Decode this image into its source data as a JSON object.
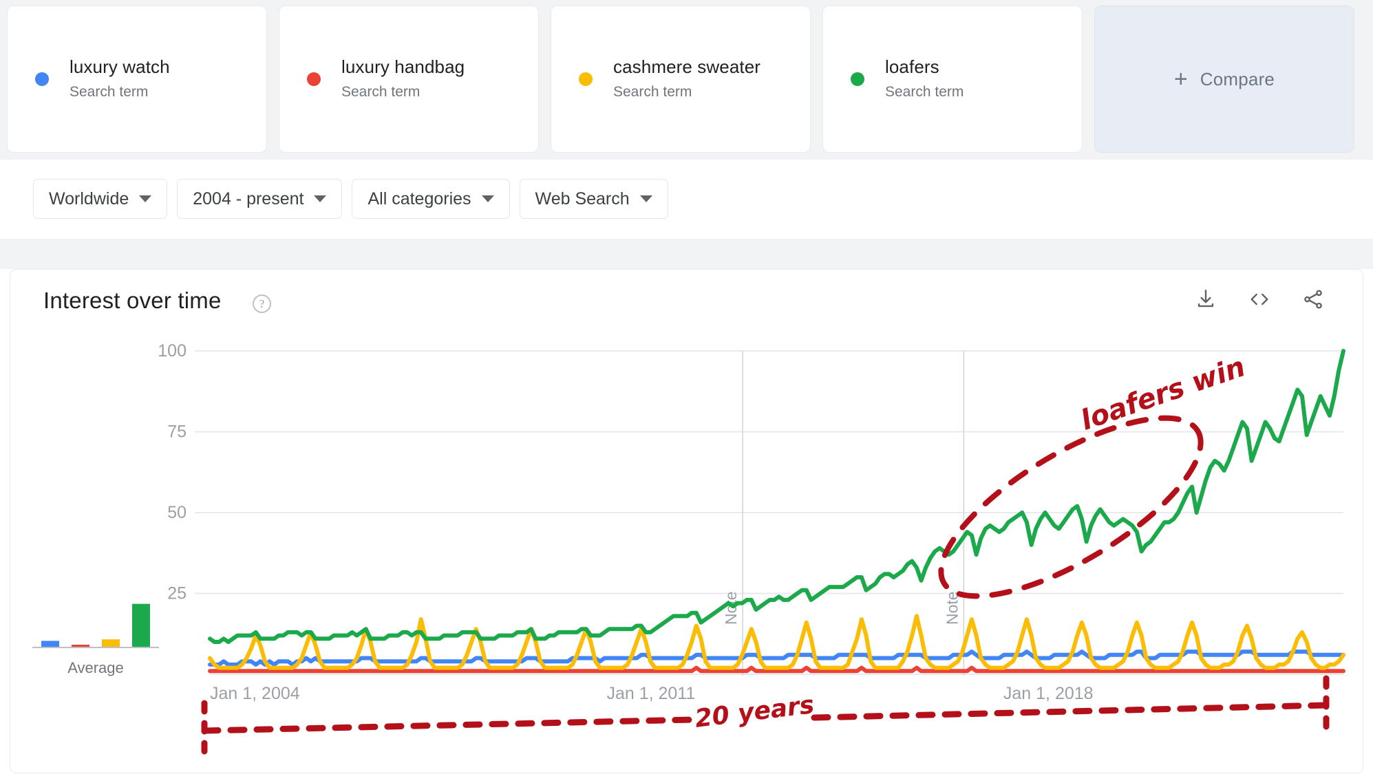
{
  "terms": [
    {
      "name": "luxury watch",
      "type_label": "Search term",
      "color": "#4285F4",
      "dot_icon": "series-dot-icon"
    },
    {
      "name": "luxury handbag",
      "type_label": "Search term",
      "color": "#EA4335",
      "dot_icon": "series-dot-icon"
    },
    {
      "name": "cashmere sweater",
      "type_label": "Search term",
      "color": "#FBBC05",
      "dot_icon": "series-dot-icon"
    },
    {
      "name": "loafers",
      "type_label": "Search term",
      "color": "#1BA94C",
      "dot_icon": "series-dot-icon"
    }
  ],
  "compare": {
    "label": "Compare",
    "plus_icon": "plus-icon"
  },
  "filters": [
    {
      "name": "region",
      "value": "Worldwide",
      "caret_icon": "chevron-down-icon"
    },
    {
      "name": "time",
      "value": "2004 - present",
      "caret_icon": "chevron-down-icon"
    },
    {
      "name": "category",
      "value": "All categories",
      "caret_icon": "chevron-down-icon"
    },
    {
      "name": "search_type",
      "value": "Web Search",
      "caret_icon": "chevron-down-icon"
    }
  ],
  "panel": {
    "title": "Interest over time",
    "help_icon": "help-circle-icon",
    "actions": [
      {
        "name": "download",
        "icon": "download-icon"
      },
      {
        "name": "embed",
        "icon": "code-embed-icon"
      },
      {
        "name": "share",
        "icon": "share-icon"
      }
    ]
  },
  "mini_chart": {
    "label": "Average",
    "values": [
      4,
      1,
      5,
      29
    ]
  },
  "annotations": {
    "loafers_win": "loafers win",
    "twenty_years": "20 years",
    "note_marker_label": "Note"
  },
  "chart_data": {
    "type": "line",
    "title": "Interest over time",
    "xlabel": "",
    "ylabel": "",
    "ylim": [
      0,
      100
    ],
    "yticks": [
      25,
      50,
      75,
      100
    ],
    "grid": true,
    "legend_position": "top-cards",
    "xtick_labels": [
      "Jan 1, 2004",
      "Jan 1, 2011",
      "Jan 1, 2018"
    ],
    "xtick_positions": [
      0,
      0.35,
      0.7
    ],
    "note_markers": [
      0.47,
      0.665
    ],
    "series": [
      {
        "name": "luxury watch",
        "color": "#4285F4",
        "values": [
          3,
          3,
          3,
          4,
          3,
          3,
          3,
          4,
          4,
          4,
          3,
          4,
          3,
          4,
          3,
          4,
          4,
          4,
          3,
          4,
          4,
          5,
          4,
          5,
          4,
          4,
          4,
          4,
          4,
          4,
          4,
          4,
          4,
          5,
          5,
          5,
          4,
          4,
          4,
          4,
          4,
          4,
          4,
          4,
          4,
          4,
          5,
          5,
          4,
          4,
          4,
          4,
          4,
          4,
          4,
          4,
          4,
          4,
          5,
          5,
          4,
          4,
          4,
          4,
          4,
          4,
          4,
          4,
          4,
          5,
          5,
          5,
          4,
          4,
          4,
          4,
          4,
          4,
          4,
          5,
          5,
          5,
          5,
          5,
          5,
          4,
          5,
          5,
          5,
          5,
          5,
          5,
          5,
          5,
          6,
          6,
          5,
          5,
          5,
          5,
          5,
          5,
          5,
          5,
          5,
          5,
          6,
          6,
          5,
          5,
          5,
          5,
          5,
          5,
          5,
          5,
          5,
          6,
          6,
          6,
          5,
          5,
          5,
          5,
          5,
          5,
          6,
          6,
          6,
          6,
          6,
          6,
          5,
          5,
          5,
          5,
          5,
          6,
          6,
          6,
          6,
          6,
          6,
          6,
          5,
          5,
          5,
          5,
          5,
          5,
          6,
          6,
          6,
          6,
          6,
          6,
          5,
          5,
          5,
          5,
          5,
          5,
          6,
          6,
          6,
          6,
          7,
          6,
          5,
          5,
          5,
          5,
          5,
          6,
          6,
          6,
          6,
          6,
          7,
          6,
          5,
          5,
          5,
          5,
          6,
          6,
          6,
          6,
          6,
          6,
          7,
          6,
          5,
          5,
          5,
          5,
          6,
          6,
          6,
          6,
          6,
          6,
          7,
          7,
          5,
          5,
          5,
          6,
          6,
          6,
          6,
          6,
          6,
          7,
          7,
          7,
          6,
          6,
          6,
          6,
          6,
          6,
          6,
          6,
          6,
          7,
          7,
          7,
          6,
          6,
          6,
          6,
          6,
          6,
          6,
          6,
          7,
          7,
          7,
          7,
          6,
          6,
          6,
          6,
          6,
          6,
          6,
          6
        ]
      },
      {
        "name": "luxury handbag",
        "color": "#EA4335",
        "values": [
          1,
          1,
          1,
          1,
          1,
          1,
          1,
          1,
          1,
          1,
          1,
          1,
          1,
          1,
          1,
          1,
          1,
          1,
          1,
          1,
          1,
          1,
          1,
          1,
          1,
          1,
          1,
          1,
          1,
          1,
          1,
          1,
          1,
          1,
          1,
          1,
          1,
          1,
          1,
          1,
          1,
          1,
          1,
          1,
          1,
          1,
          1,
          1,
          1,
          1,
          1,
          1,
          1,
          1,
          1,
          1,
          1,
          1,
          1,
          1,
          1,
          1,
          1,
          1,
          1,
          1,
          1,
          1,
          1,
          1,
          1,
          1,
          1,
          1,
          1,
          1,
          1,
          1,
          1,
          1,
          1,
          1,
          1,
          1,
          1,
          1,
          1,
          1,
          1,
          1,
          1,
          1,
          1,
          1,
          1,
          1,
          1,
          1,
          1,
          1,
          1,
          1,
          1,
          1,
          1,
          1,
          2,
          1,
          1,
          1,
          1,
          1,
          1,
          1,
          1,
          1,
          1,
          1,
          2,
          1,
          1,
          1,
          1,
          1,
          1,
          1,
          1,
          1,
          1,
          1,
          2,
          1,
          1,
          1,
          1,
          1,
          1,
          1,
          1,
          1,
          1,
          1,
          2,
          1,
          1,
          1,
          1,
          1,
          1,
          1,
          1,
          1,
          1,
          1,
          2,
          1,
          1,
          1,
          1,
          1,
          1,
          1,
          1,
          1,
          1,
          1,
          2,
          1,
          1,
          1,
          1,
          1,
          1,
          1,
          1,
          1,
          1,
          1,
          1,
          1,
          1,
          1,
          1,
          1,
          1,
          1,
          1,
          1,
          1,
          1,
          1,
          1,
          1,
          1,
          1,
          1,
          1,
          1,
          1,
          1,
          1,
          1,
          1,
          1,
          1,
          1,
          1,
          1,
          1,
          1,
          1,
          1,
          1,
          1,
          1,
          1,
          1,
          1,
          1,
          1,
          1,
          1,
          1,
          1,
          1,
          1,
          1,
          1,
          1,
          1,
          1,
          1,
          1,
          1,
          1,
          1,
          1,
          1,
          1,
          1,
          1,
          1,
          1,
          1,
          1,
          1,
          1,
          1
        ]
      },
      {
        "name": "cashmere sweater",
        "color": "#FBBC05",
        "values": [
          5,
          3,
          2,
          2,
          2,
          2,
          2,
          3,
          5,
          8,
          12,
          9,
          4,
          2,
          2,
          2,
          2,
          2,
          2,
          3,
          5,
          9,
          13,
          9,
          4,
          2,
          2,
          2,
          2,
          2,
          2,
          3,
          5,
          9,
          14,
          10,
          4,
          2,
          2,
          2,
          2,
          2,
          2,
          3,
          6,
          10,
          17,
          11,
          4,
          2,
          2,
          2,
          2,
          2,
          2,
          3,
          6,
          10,
          14,
          10,
          4,
          2,
          2,
          2,
          2,
          2,
          2,
          3,
          6,
          10,
          14,
          10,
          4,
          2,
          2,
          2,
          2,
          2,
          2,
          3,
          6,
          10,
          14,
          10,
          4,
          2,
          2,
          2,
          2,
          2,
          2,
          3,
          6,
          10,
          14,
          10,
          4,
          2,
          2,
          2,
          2,
          2,
          2,
          3,
          6,
          10,
          15,
          11,
          4,
          2,
          2,
          2,
          2,
          2,
          2,
          3,
          6,
          10,
          14,
          10,
          4,
          2,
          2,
          2,
          2,
          2,
          2,
          3,
          6,
          11,
          16,
          11,
          4,
          2,
          2,
          2,
          2,
          2,
          2,
          3,
          7,
          11,
          17,
          12,
          4,
          2,
          2,
          2,
          2,
          2,
          2,
          4,
          7,
          12,
          18,
          12,
          5,
          3,
          2,
          2,
          2,
          2,
          3,
          4,
          7,
          12,
          17,
          12,
          5,
          3,
          2,
          2,
          2,
          2,
          3,
          4,
          7,
          12,
          17,
          12,
          5,
          3,
          2,
          2,
          2,
          2,
          3,
          4,
          7,
          12,
          16,
          12,
          5,
          3,
          2,
          2,
          2,
          2,
          3,
          4,
          7,
          12,
          16,
          12,
          5,
          3,
          2,
          2,
          2,
          2,
          3,
          4,
          7,
          12,
          16,
          12,
          5,
          3,
          2,
          2,
          2,
          3,
          3,
          4,
          7,
          12,
          15,
          11,
          5,
          3,
          2,
          2,
          2,
          3,
          3,
          4,
          7,
          11,
          13,
          10,
          5,
          3,
          2,
          2,
          3,
          3,
          4,
          6
        ]
      },
      {
        "name": "loafers",
        "color": "#1BA94C",
        "values": [
          11,
          10,
          10,
          11,
          10,
          11,
          12,
          12,
          12,
          12,
          13,
          11,
          11,
          11,
          11,
          12,
          12,
          13,
          13,
          13,
          12,
          13,
          13,
          11,
          11,
          11,
          11,
          12,
          12,
          12,
          12,
          13,
          12,
          13,
          14,
          11,
          11,
          11,
          11,
          12,
          12,
          12,
          13,
          13,
          12,
          13,
          13,
          11,
          11,
          11,
          11,
          12,
          12,
          12,
          12,
          13,
          13,
          13,
          13,
          11,
          11,
          11,
          11,
          12,
          12,
          12,
          12,
          13,
          13,
          13,
          14,
          11,
          11,
          11,
          12,
          12,
          13,
          13,
          13,
          13,
          13,
          14,
          14,
          12,
          12,
          12,
          13,
          14,
          14,
          14,
          14,
          14,
          14,
          15,
          15,
          13,
          13,
          14,
          15,
          16,
          17,
          18,
          18,
          18,
          18,
          19,
          19,
          16,
          17,
          18,
          19,
          20,
          21,
          22,
          21,
          22,
          22,
          23,
          23,
          20,
          21,
          22,
          23,
          23,
          24,
          23,
          23,
          24,
          25,
          26,
          26,
          23,
          24,
          25,
          26,
          27,
          27,
          27,
          27,
          28,
          29,
          30,
          30,
          26,
          27,
          28,
          30,
          31,
          31,
          30,
          31,
          32,
          34,
          35,
          33,
          29,
          33,
          36,
          38,
          39,
          38,
          37,
          38,
          40,
          42,
          44,
          43,
          37,
          42,
          45,
          46,
          45,
          44,
          45,
          47,
          48,
          49,
          50,
          47,
          40,
          45,
          48,
          50,
          48,
          46,
          45,
          47,
          49,
          51,
          52,
          48,
          41,
          46,
          49,
          51,
          49,
          47,
          46,
          47,
          48,
          47,
          46,
          44,
          38,
          40,
          41,
          43,
          45,
          47,
          47,
          48,
          50,
          53,
          56,
          58,
          50,
          55,
          60,
          64,
          66,
          65,
          63,
          66,
          70,
          74,
          78,
          76,
          66,
          70,
          74,
          78,
          76,
          73,
          72,
          76,
          80,
          84,
          88,
          86,
          74,
          78,
          82,
          86,
          83,
          80,
          86,
          94,
          100
        ]
      }
    ]
  }
}
